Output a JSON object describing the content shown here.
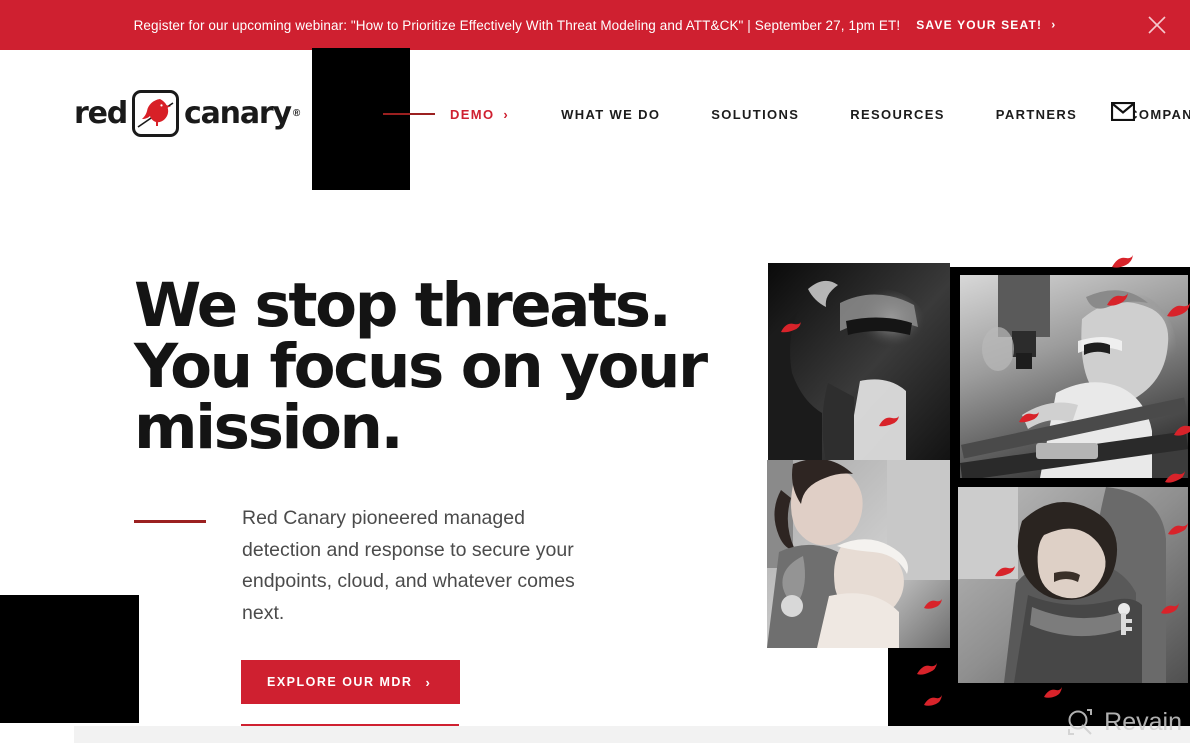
{
  "banner": {
    "message": "Register for our upcoming webinar: \"How to Prioritize Effectively With Threat Modeling and ATT&CK\" | September 27, 1pm ET!",
    "cta_label": "SAVE YOUR SEAT!",
    "cta_chevron": "›",
    "close_icon": "close-icon",
    "background_color": "#cf2030",
    "text_color": "#ffffff"
  },
  "header": {
    "logo": {
      "word_left": "red",
      "word_right": "canary",
      "registered_mark": "®",
      "mark_icon": "canary-bird-icon",
      "bird_color": "#d82027"
    },
    "nav": [
      {
        "label": "DEMO",
        "highlighted": true,
        "chevron": "›"
      },
      {
        "label": "WHAT WE DO",
        "highlighted": false
      },
      {
        "label": "SOLUTIONS",
        "highlighted": false
      },
      {
        "label": "RESOURCES",
        "highlighted": false
      },
      {
        "label": "PARTNERS",
        "highlighted": false
      },
      {
        "label": "COMPANY",
        "highlighted": false
      }
    ],
    "mail_icon": "mail-envelope-icon",
    "accent_color": "#cf2030"
  },
  "hero": {
    "headline": "We stop threats.\nYou focus on your\nmission.",
    "paragraph": "Red Canary pioneered managed detection and response to secure your endpoints, cloud, and whatever comes next.",
    "cta_label": "EXPLORE OUR MDR",
    "cta_chevron": "›",
    "cta_color": "#cf2030",
    "accent_dash_color": "#9b2020"
  },
  "collage": {
    "photos": [
      {
        "name": "photo-vr-headset",
        "description": "Person wearing VR headset in leather jacket, black and white"
      },
      {
        "name": "photo-lab-technician",
        "description": "Technician with safety glasses working at a machine, black and white"
      },
      {
        "name": "photo-nurse-and-child",
        "description": "Nurse smiling with a child patient, black and white"
      },
      {
        "name": "photo-embrace",
        "description": "Two people embracing, black and white"
      }
    ],
    "bird_accents_color": "#d8232a",
    "panel_color": "#000000"
  },
  "watermark": {
    "label": "Revain",
    "icon": "revain-logo-icon",
    "color": "#cfcfcf"
  }
}
